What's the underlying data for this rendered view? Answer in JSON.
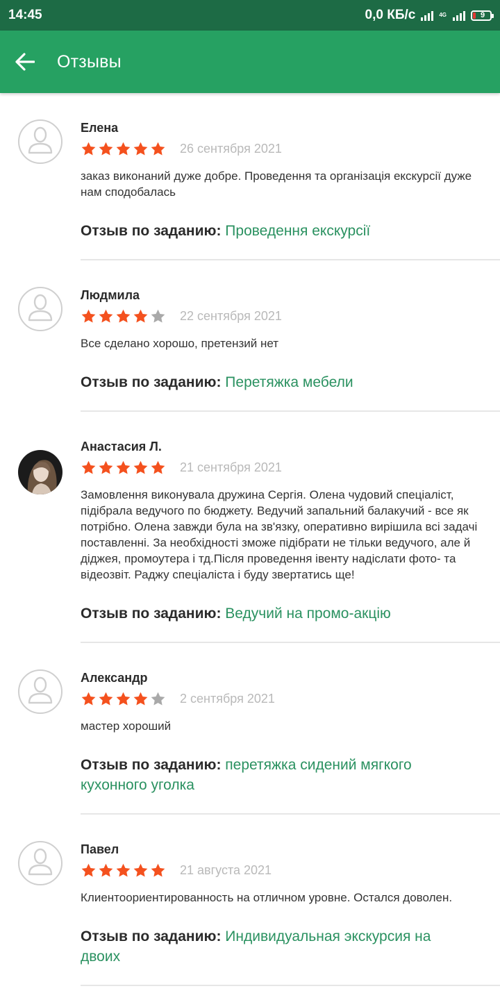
{
  "status_bar": {
    "time": "14:45",
    "net_speed": "0,0 КБ/с",
    "network_type": "4G",
    "battery_level": "9",
    "icons": [
      "signal-icon",
      "signal-4g-icon",
      "battery-icon"
    ]
  },
  "app_bar": {
    "title": "Отзывы",
    "back_icon": "arrow-back-icon"
  },
  "task_label": "Отзыв по заданию:",
  "colors": {
    "status_bar": "#1d6b45",
    "app_bar": "#26a162",
    "star_filled": "#f4511e",
    "star_empty": "#a9a9a9",
    "task_link": "#2a9160"
  },
  "reviews": [
    {
      "name": "Елена",
      "rating": 5,
      "date": "26 сентября 2021",
      "text": "заказ виконаний дуже добре. Проведення та організація екскурсії дуже нам сподобалась",
      "task": "Проведення екскурсії",
      "avatar": "user-placeholder-icon"
    },
    {
      "name": "Людмила",
      "rating": 4,
      "date": "22 сентября 2021",
      "text": "Все сделано хорошо, претензий нет",
      "task": "Перетяжка мебели",
      "avatar": "user-placeholder-icon"
    },
    {
      "name": "Анастасия Л.",
      "rating": 5,
      "date": "21 сентября 2021",
      "text": "Замовлення виконувала дружина Сергія. Олена чудовий спеціаліст, підібрала ведучого по бюджету. Ведучий запальний балакучий - все як потрібно. Олена завжди була на зв'язку, оперативно вирішила всі задачі поставленні. За необхідності зможе підібрати не тільки ведучого, але й діджея, промоутера і тд.Після проведення івенту надіслати фото- та відеозвіт. Раджу спеціаліста і  буду звертатись ще!",
      "task": "Ведучий на промо-акцію",
      "avatar": "user-photo"
    },
    {
      "name": "Александр",
      "rating": 4,
      "date": "2 сентября 2021",
      "text": "мастер хороший",
      "task": "перетяжка сидений мягкого кухонного уголка",
      "avatar": "user-placeholder-icon"
    },
    {
      "name": "Павел",
      "rating": 5,
      "date": "21 августа 2021",
      "text": "Клиентоориентированность на отличном уровне. Остался доволен.",
      "task": "Индивидуальная экскурсия на двоих",
      "avatar": "user-placeholder-icon"
    }
  ]
}
